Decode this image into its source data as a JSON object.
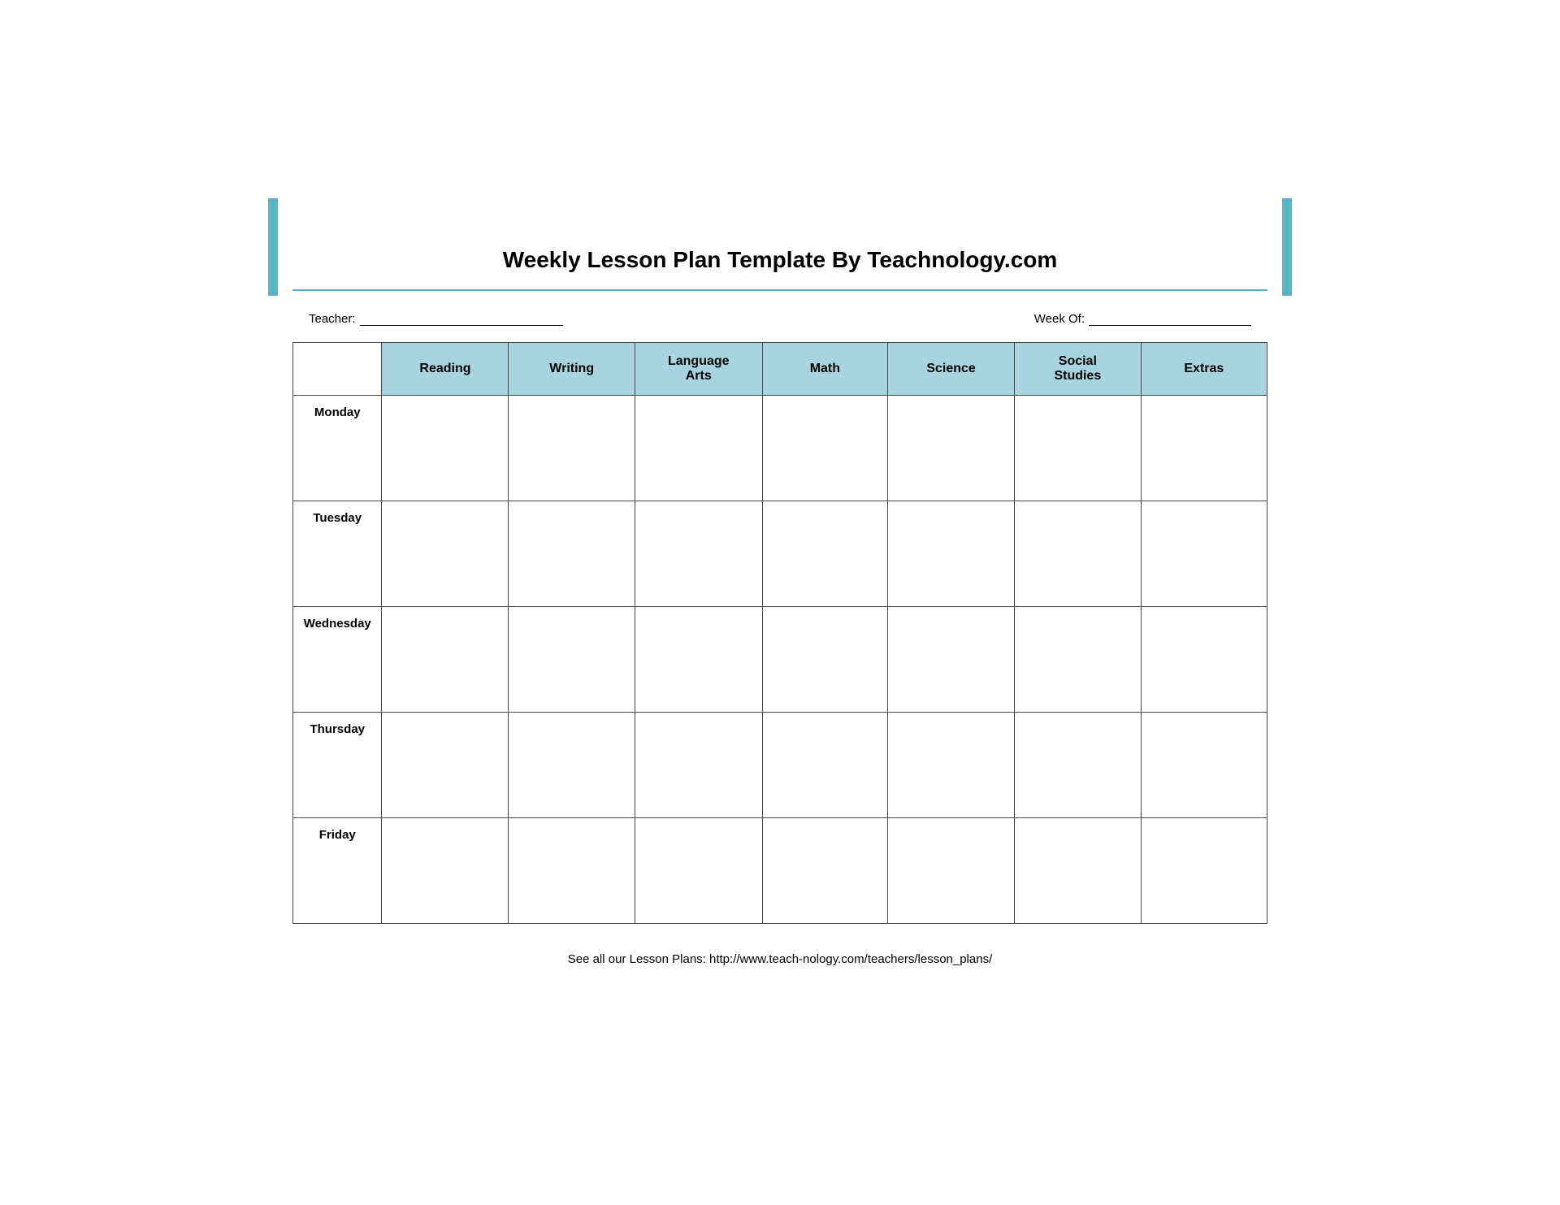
{
  "page": {
    "title": "Weekly Lesson Plan Template By Teachnology.com",
    "teacher_label": "Teacher:",
    "week_of_label": "Week Of:",
    "footer": "See all our Lesson Plans: http://www.teach-nology.com/teachers/lesson_plans/"
  },
  "table": {
    "headers": [
      {
        "id": "corner",
        "label": ""
      },
      {
        "id": "reading",
        "label": "Reading"
      },
      {
        "id": "writing",
        "label": "Writing"
      },
      {
        "id": "language-arts",
        "label": "Language Arts"
      },
      {
        "id": "math",
        "label": "Math"
      },
      {
        "id": "science",
        "label": "Science"
      },
      {
        "id": "social-studies",
        "label": "Social Studies"
      },
      {
        "id": "extras",
        "label": "Extras"
      }
    ],
    "days": [
      {
        "id": "monday",
        "label": "Monday"
      },
      {
        "id": "tuesday",
        "label": "Tuesday"
      },
      {
        "id": "wednesday",
        "label": "Wednesday"
      },
      {
        "id": "thursday",
        "label": "Thursday"
      },
      {
        "id": "friday",
        "label": "Friday"
      }
    ]
  },
  "colors": {
    "header_bg": "#a8d4e0",
    "accent": "#5ab4c5",
    "border": "#444444"
  }
}
